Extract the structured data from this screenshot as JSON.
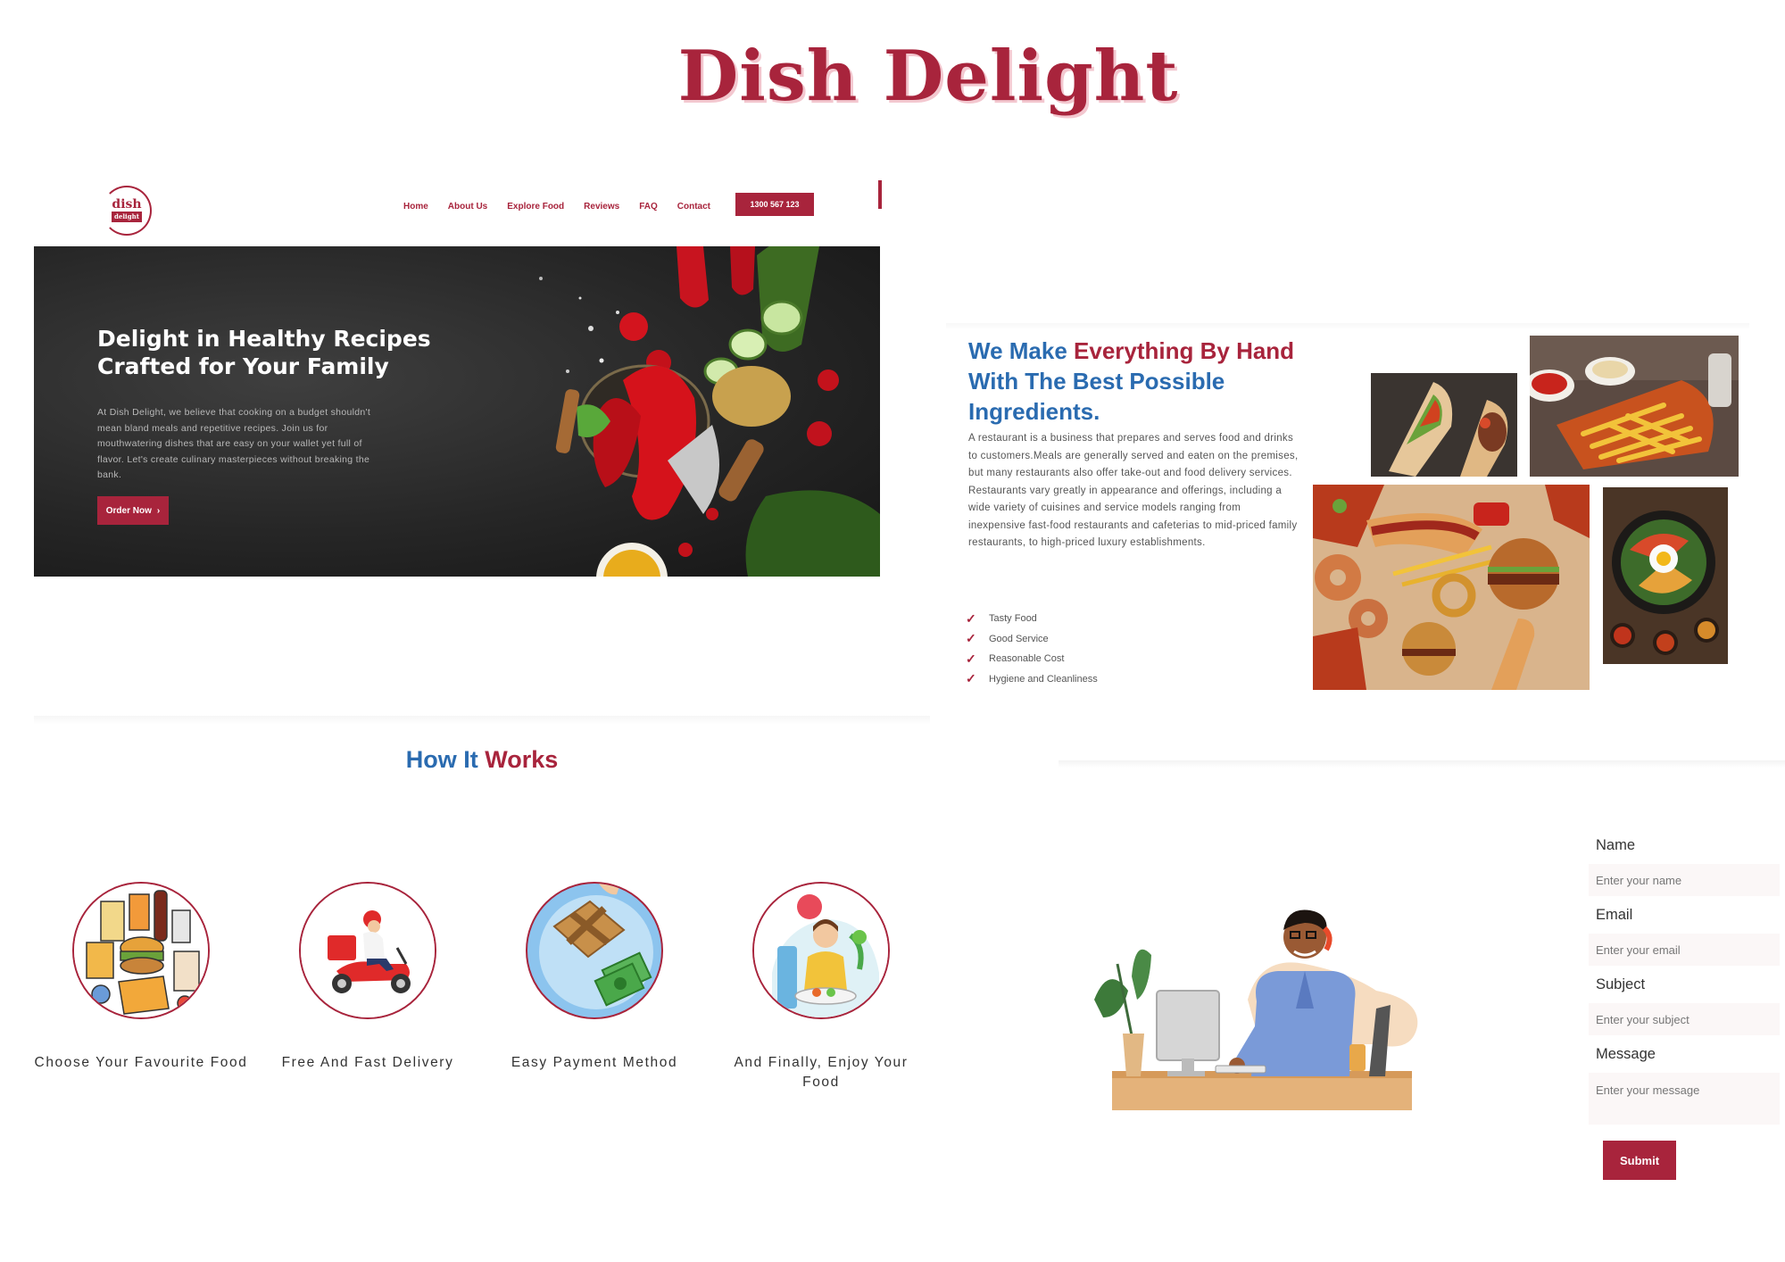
{
  "brand": {
    "title": "Dish Delight"
  },
  "header": {
    "logo_text": "dish",
    "logo_sub": "delight",
    "nav": [
      "Home",
      "About Us",
      "Explore Food",
      "Reviews",
      "FAQ",
      "Contact"
    ],
    "phone": "1300 567 123"
  },
  "hero": {
    "title": "Delight in Healthy Recipes Crafted for Your Family",
    "description": "At Dish Delight, we believe that cooking on a budget shouldn't mean bland meals and repetitive recipes. Join us for mouthwatering dishes that are easy on your wallet yet full of flavor. Let's create culinary masterpieces without breaking the bank.",
    "button": "Order Now"
  },
  "about": {
    "title_part1": "We Make ",
    "title_accent": "Everything By Hand",
    "title_part2": " With The Best Possible Ingredients.",
    "paragraph1": "A restaurant is a business that prepares and serves food and drinks to customers.Meals are generally served and eaten on the premises, but many restaurants also offer take-out and food delivery services.",
    "paragraph2": "Restaurants vary greatly in appearance and offerings, including a wide variety of cuisines and service models ranging from inexpensive fast-food restaurants and cafeterias to mid-priced family restaurants, to high-priced luxury establishments.",
    "features": [
      "Tasty Food",
      "Good Service",
      "Reasonable Cost",
      "Hygiene and Cleanliness"
    ]
  },
  "how": {
    "title_part1": "How It ",
    "title_accent": "Works",
    "steps": [
      {
        "label": "Choose Your Favourite Food",
        "icon": "groceries-icon"
      },
      {
        "label": "Free And Fast Delivery",
        "icon": "delivery-scooter-icon"
      },
      {
        "label": "Easy Payment Method",
        "icon": "payment-icon"
      },
      {
        "label": "And Finally, Enjoy Your Food",
        "icon": "enjoy-food-icon"
      }
    ]
  },
  "contact": {
    "name_label": "Name",
    "name_placeholder": "Enter your name",
    "email_label": "Email",
    "email_placeholder": "Enter your email",
    "subject_label": "Subject",
    "subject_placeholder": "Enter your subject",
    "message_label": "Message",
    "message_placeholder": "Enter your message",
    "submit": "Submit"
  },
  "colors": {
    "accent": "#a8243c",
    "blue": "#2a6bb0"
  }
}
